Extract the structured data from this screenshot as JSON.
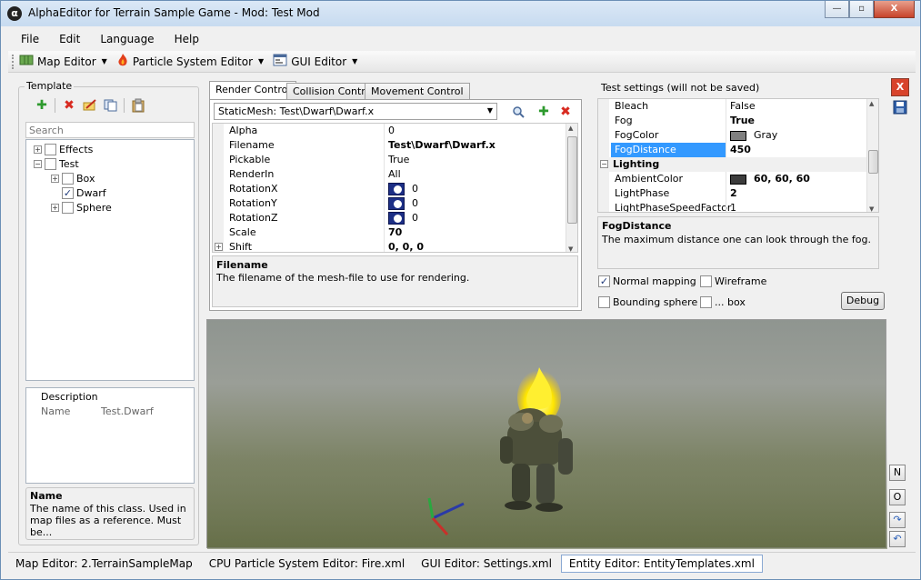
{
  "window": {
    "title": "AlphaEditor for Terrain Sample Game - Mod: Test Mod",
    "app_icon": "α",
    "controls": {
      "minimize": "—",
      "maximize": "▫",
      "close": "X"
    }
  },
  "menu": [
    "File",
    "Edit",
    "Language",
    "Help"
  ],
  "toolbar": [
    {
      "label": "Map Editor",
      "icon": "map-icon"
    },
    {
      "label": "Particle System Editor",
      "icon": "flame-icon"
    },
    {
      "label": "GUI Editor",
      "icon": "gui-icon"
    }
  ],
  "template": {
    "title": "Template",
    "search_placeholder": "Search",
    "tree": [
      {
        "label": "Effects",
        "expander": "+",
        "checked": false,
        "level": 0
      },
      {
        "label": "Test",
        "expander": "−",
        "checked": false,
        "level": 0
      },
      {
        "label": "Box",
        "expander": "+",
        "checked": false,
        "level": 1
      },
      {
        "label": "Dwarf",
        "expander": "",
        "checked": true,
        "level": 1
      },
      {
        "label": "Sphere",
        "expander": "+",
        "checked": false,
        "level": 1
      }
    ],
    "description_header": "Description",
    "description_rows": [
      {
        "key": "Name",
        "value": "Test.Dwarf"
      }
    ],
    "help_title": "Name",
    "help_text": "The name of this class. Used in map files as a reference. Must be..."
  },
  "render": {
    "tabs": [
      "Render Control",
      "Collision Control",
      "Movement Control"
    ],
    "combo_value": "StaticMesh: Test\\Dwarf\\Dwarf.x",
    "properties": [
      {
        "name": "Alpha",
        "value": "0",
        "bold": false,
        "icon": false,
        "expander": false
      },
      {
        "name": "Filename",
        "value": "Test\\Dwarf\\Dwarf.x",
        "bold": true,
        "icon": false,
        "expander": false
      },
      {
        "name": "Pickable",
        "value": "True",
        "bold": false,
        "icon": false,
        "expander": false
      },
      {
        "name": "RenderIn",
        "value": "All",
        "bold": false,
        "icon": false,
        "expander": false
      },
      {
        "name": "RotationX",
        "value": "0",
        "bold": false,
        "icon": true,
        "expander": false
      },
      {
        "name": "RotationY",
        "value": "0",
        "bold": false,
        "icon": true,
        "expander": false
      },
      {
        "name": "RotationZ",
        "value": "0",
        "bold": false,
        "icon": true,
        "expander": false
      },
      {
        "name": "Scale",
        "value": "70",
        "bold": true,
        "icon": false,
        "expander": false
      },
      {
        "name": "Shift",
        "value": "0, 0, 0",
        "bold": true,
        "icon": false,
        "expander": true
      }
    ],
    "help_title": "Filename",
    "help_text": "The filename of the mesh-file to use for rendering."
  },
  "test_settings": {
    "title": "Test settings  (will not be saved)",
    "properties": [
      {
        "name": "Bleach",
        "value": "False",
        "bold": false,
        "swatch": null,
        "selected": false
      },
      {
        "name": "Fog",
        "value": "True",
        "bold": true,
        "swatch": null,
        "selected": false
      },
      {
        "name": "FogColor",
        "value": "Gray",
        "bold": false,
        "swatch": "#808080",
        "selected": false
      },
      {
        "name": "FogDistance",
        "value": "450",
        "bold": true,
        "swatch": null,
        "selected": true
      },
      {
        "name": "Lighting",
        "value": "",
        "bold": true,
        "swatch": null,
        "selected": false,
        "category": true
      },
      {
        "name": "AmbientColor",
        "value": "60, 60, 60",
        "bold": true,
        "swatch": "#3c3c3c",
        "selected": false
      },
      {
        "name": "LightPhase",
        "value": "2",
        "bold": true,
        "swatch": null,
        "selected": false
      },
      {
        "name": "LightPhaseSpeedFactor",
        "value": "1",
        "bold": false,
        "swatch": null,
        "selected": false
      }
    ],
    "help_title": "FogDistance",
    "help_text": "The maximum distance one can look through the fog.",
    "checks": [
      {
        "label": "Normal mapping",
        "checked": true
      },
      {
        "label": "Wireframe",
        "checked": false
      },
      {
        "label": "Bounding sphere",
        "checked": false
      },
      {
        "label": "... box",
        "checked": false
      }
    ],
    "debug_label": "Debug"
  },
  "side_buttons": [
    "N",
    "O"
  ],
  "status_tabs": [
    {
      "label": "Map Editor: 2.TerrainSampleMap",
      "active": false
    },
    {
      "label": "CPU Particle System Editor: Fire.xml",
      "active": false
    },
    {
      "label": "GUI Editor: Settings.xml",
      "active": false
    },
    {
      "label": "Entity Editor: EntityTemplates.xml",
      "active": true
    }
  ],
  "colors": {
    "selection": "#3399ff",
    "close_red": "#d8432b",
    "sky": "#9a9e97",
    "ground": "#6e7651"
  }
}
